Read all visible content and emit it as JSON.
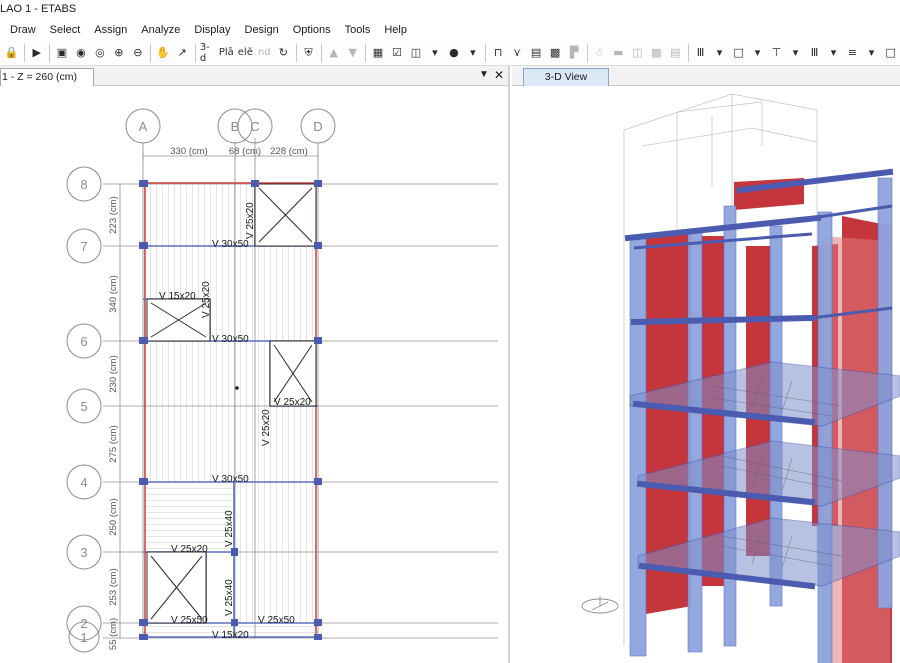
{
  "window": {
    "title": "LAO 1 - ETABS"
  },
  "menu": [
    "Draw",
    "Select",
    "Assign",
    "Analyze",
    "Display",
    "Design",
    "Options",
    "Tools",
    "Help"
  ],
  "toolbar": {
    "view_3d_label": "3-d",
    "plan_label": "Plā",
    "elev_label": "elĕ",
    "nd_label": "nd",
    "dropdown_glyph": "▾"
  },
  "plan_view": {
    "tab_label": "1 - Z = 260 (cm)",
    "grid_columns": [
      "A",
      "B",
      "C",
      "D"
    ],
    "grid_rows": [
      "8",
      "7",
      "6",
      "5",
      "4",
      "3",
      "2",
      "1"
    ],
    "column_spacings": [
      "330 (cm)",
      "68 (cm)",
      "228 (cm)"
    ],
    "row_spacings": [
      "223 (cm)",
      "340 (cm)",
      "230 (cm)",
      "275 (cm)",
      "250 (cm)",
      "253 (cm)",
      "55 (cm)"
    ],
    "beam_labels": [
      "V 30x50",
      "V 25x20",
      "V 15x20",
      "V 25x20",
      "V 30x50",
      "V 25x20",
      "V 25x20",
      "V 30x50",
      "V 25x40",
      "V 25x20",
      "V 25x40",
      "V 25x50",
      "V 25x50",
      "V 15x20"
    ]
  },
  "model_view": {
    "tab_label": "3-D View"
  },
  "colors": {
    "beam": "#5b6fc4",
    "slab_line": "#c9c9c9",
    "wall_red": "#c0262c",
    "column_blue": "#8ea4de",
    "grid_line": "#909090",
    "bubble": "#8c8c8c"
  }
}
